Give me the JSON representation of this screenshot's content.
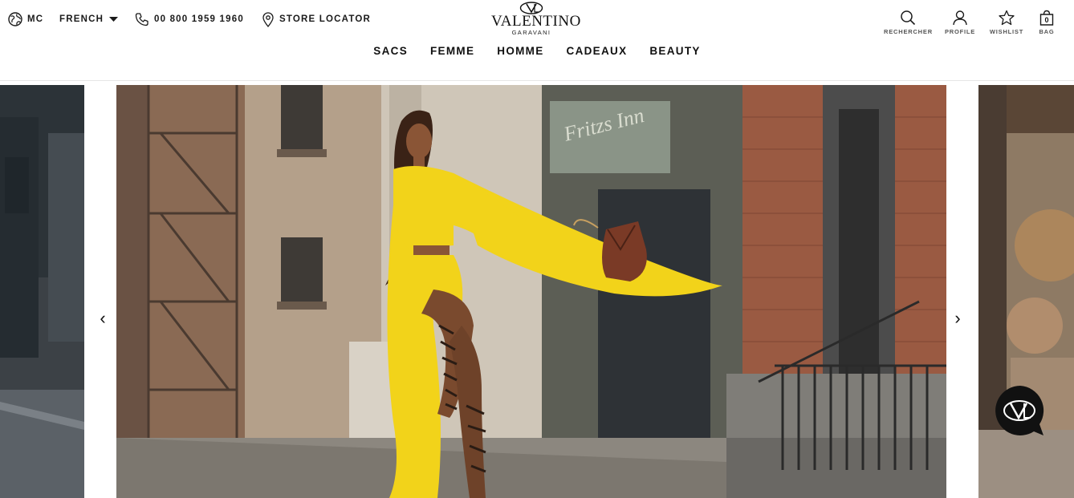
{
  "header": {
    "region": "MC",
    "language": "FRENCH",
    "phone": "00 800 1959 1960",
    "store_locator": "STORE LOCATOR",
    "logo": {
      "wordmark": "VALENTINO",
      "subline": "GARAVANI"
    },
    "nav": [
      "SACS",
      "FEMME",
      "HOMME",
      "CADEAUX",
      "BEAUTY"
    ],
    "tools": {
      "search": "RECHERCHER",
      "profile": "PROFILE",
      "wishlist": "WISHLIST",
      "bag": "BAG",
      "bag_count": "0"
    }
  },
  "carousel": {
    "prev_arrow": "‹",
    "next_arrow": "›",
    "main_slide": {
      "background_sign": "Fritzs Inn",
      "outfit_color": "#f2d31a",
      "bag_color": "#7a3a26"
    }
  },
  "chat_widget": {
    "icon": "valentino-vl-monogram-icon"
  }
}
